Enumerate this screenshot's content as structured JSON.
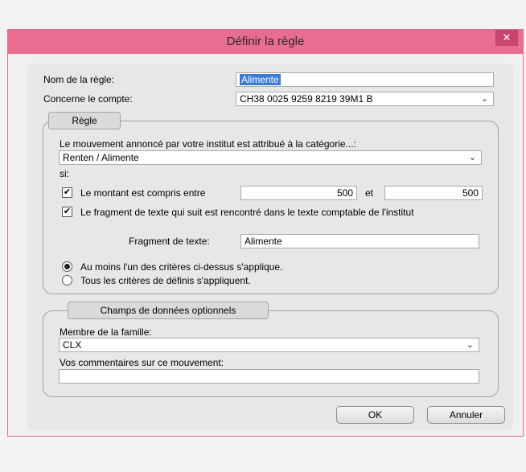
{
  "window": {
    "title": "Définir la règle",
    "close_glyph": "✕"
  },
  "form": {
    "rule_name_label": "Nom de la règle:",
    "rule_name_value": "Alimente",
    "account_label": "Concerne le compte:",
    "account_value": "CH38 0025 9259 8219 39M1 B"
  },
  "rule_group": {
    "legend": "Règle",
    "category_label": "Le mouvement annoncé par votre institut est attribué à la catégorie...:",
    "category_value": "Renten / Alimente",
    "si_label": "si:",
    "amount_check_label": "Le montant est compris entre",
    "amount_checked": true,
    "amount_from": "500",
    "and_label": "et",
    "amount_to": "500",
    "text_check_label": "Le fragment de texte qui suit est rencontré dans le texte comptable de l'institut",
    "text_checked": true,
    "fragment_label": "Fragment de texte:",
    "fragment_value": "Alimente",
    "radio_any_label": "Au moins l'un des critères ci-dessus s'applique.",
    "radio_all_label": "Tous les critères de définis s'appliquent.",
    "selected_radio": "any"
  },
  "optional_group": {
    "legend": "Champs de données optionnels",
    "family_label": "Membre de la famille:",
    "family_value": "CLX",
    "comments_label": "Vos commentaires sur ce mouvement:",
    "comments_value": ""
  },
  "buttons": {
    "ok": "OK",
    "cancel": "Annuler"
  },
  "icons": {
    "dropdown": "chevron-down-icon",
    "check": "✔"
  },
  "colors": {
    "titlebar": "#e96c91",
    "close": "#c9456f",
    "selection": "#3a7bd5"
  }
}
